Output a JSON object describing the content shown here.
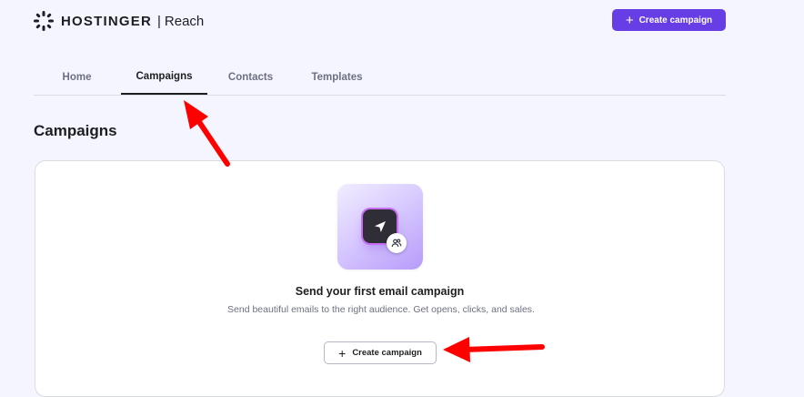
{
  "header": {
    "brand": "HOSTINGER",
    "separator": "|",
    "product": "Reach",
    "create_button_label": "Create campaign",
    "create_button_icon": "plus-icon"
  },
  "tabs": [
    {
      "label": "Home",
      "active": false
    },
    {
      "label": "Campaigns",
      "active": true
    },
    {
      "label": "Contacts",
      "active": false
    },
    {
      "label": "Templates",
      "active": false
    }
  ],
  "page": {
    "title": "Campaigns"
  },
  "empty_state": {
    "illustration_icons": [
      "send-icon",
      "users-icon"
    ],
    "title": "Send your first email campaign",
    "description": "Send beautiful emails to the right audience. Get opens, clicks, and sales.",
    "button_label": "Create campaign",
    "button_icon": "plus-icon"
  },
  "colors": {
    "accent": "#673de6",
    "annotation_arrow": "#ff0000",
    "background": "#f4f5ff"
  }
}
